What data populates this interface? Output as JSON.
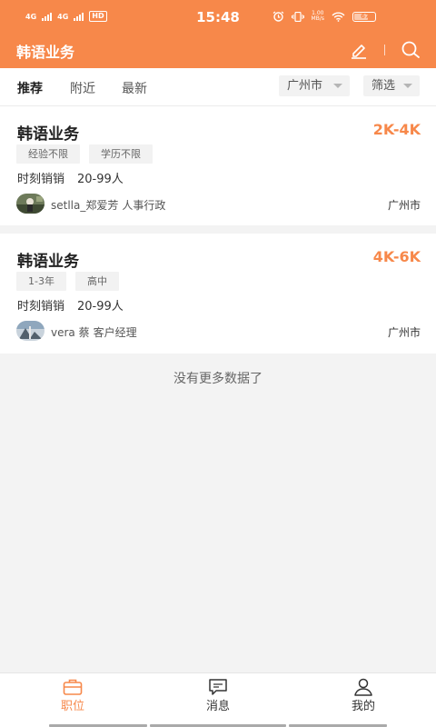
{
  "status_bar": {
    "net1": "4G",
    "net2": "4G",
    "hd": "HD",
    "time": "15:48",
    "speed_value": "1.00",
    "speed_unit": "MB/s",
    "battery": "67"
  },
  "header": {
    "title": "韩语业务",
    "edit_icon": "edit-icon",
    "search_icon": "search-icon"
  },
  "filters": {
    "tabs": [
      {
        "label": "推荐",
        "active": true
      },
      {
        "label": "附近",
        "active": false
      },
      {
        "label": "最新",
        "active": false
      }
    ],
    "city_label": "广州市",
    "filter_label": "筛选"
  },
  "jobs": [
    {
      "title": "韩语业务",
      "salary": "2K-4K",
      "tags": [
        "经验不限",
        "学历不限"
      ],
      "company": "时刻销销",
      "size": "20-99人",
      "recruiter_name": "setlla_郑爱芳",
      "recruiter_role": "人事行政",
      "city": "广州市"
    },
    {
      "title": "韩语业务",
      "salary": "4K-6K",
      "tags": [
        "1-3年",
        "高中"
      ],
      "company": "时刻销销",
      "size": "20-99人",
      "recruiter_name": "vera 蔡",
      "recruiter_role": "客户经理",
      "city": "广州市"
    }
  ],
  "no_more_text": "没有更多数据了",
  "tabbar": {
    "items": [
      {
        "label": "职位",
        "icon": "briefcase-icon",
        "active": true
      },
      {
        "label": "消息",
        "icon": "message-icon",
        "active": false
      },
      {
        "label": "我的",
        "icon": "profile-icon",
        "active": false
      }
    ]
  },
  "colors": {
    "accent": "#f7884a",
    "background": "#f3f3f3"
  }
}
